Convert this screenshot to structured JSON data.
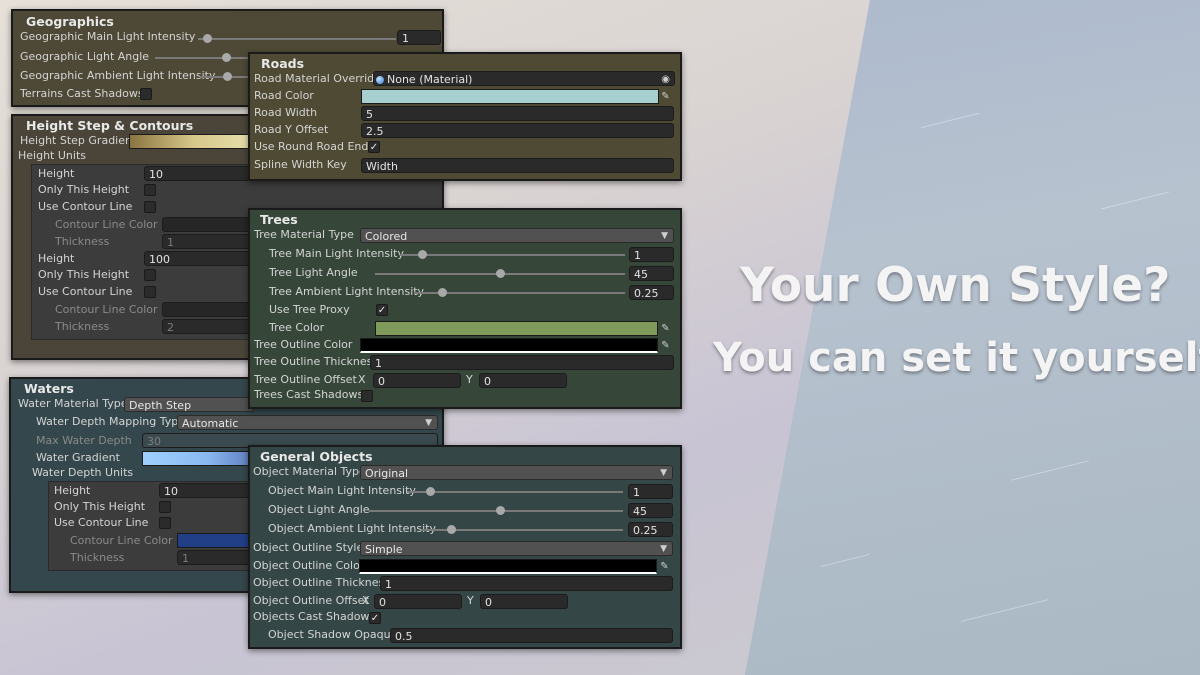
{
  "colors": {
    "geographics_bg": "#4e4936",
    "height_bg": "#4a4538",
    "roads_bg": "#4f4a33",
    "trees_bg": "#36473a",
    "waters_bg": "#34474c",
    "general_bg": "#344746",
    "road_color": "#a8cfcf",
    "tree_color": "#7f9a5a",
    "water_gradient_start": "#9fd0ff",
    "water_gradient_end": "#5f7fbf",
    "contour_blue": "#213f86"
  },
  "headline": {
    "line1": "Your Own Style?",
    "line2": "You can set it yourself"
  },
  "geographics": {
    "title": "Geographics",
    "main_light_label": "Geographic Main Light Intensity",
    "main_light_value": "1",
    "light_angle_label": "Geographic Light Angle",
    "ambient_label": "Geographic Ambient Light Intensity",
    "terrains_shadows_label": "Terrains Cast Shadows"
  },
  "height": {
    "title": "Height Step & Contours",
    "gradient_label": "Height Step Gradient",
    "units_label": "Height Units",
    "unit1": {
      "height_label": "Height",
      "height_value": "10",
      "only_label": "Only This Height",
      "contour_label": "Use Contour Line",
      "contour_color_label": "Contour Line Color",
      "thickness_label": "Thickness",
      "thickness_value": "1"
    },
    "unit2": {
      "height_label": "Height",
      "height_value": "100",
      "only_label": "Only This Height",
      "contour_label": "Use Contour Line",
      "contour_color_label": "Contour Line Color",
      "thickness_label": "Thickness",
      "thickness_value": "2"
    }
  },
  "roads": {
    "title": "Roads",
    "material_label": "Road Material Override",
    "material_value": "None (Material)",
    "color_label": "Road Color",
    "width_label": "Road Width",
    "width_value": "5",
    "yoffset_label": "Road Y Offset",
    "yoffset_value": "2.5",
    "round_ends_label": "Use Round Road Ends",
    "spline_label": "Spline Width Key",
    "spline_value": "Width"
  },
  "trees": {
    "title": "Trees",
    "material_type_label": "Tree Material Type",
    "material_type_value": "Colored",
    "main_light_label": "Tree Main Light Intensity",
    "main_light_value": "1",
    "light_angle_label": "Tree Light Angle",
    "light_angle_value": "45",
    "ambient_label": "Tree Ambient Light Intensity",
    "ambient_value": "0.25",
    "proxy_label": "Use Tree Proxy",
    "color_label": "Tree Color",
    "outline_color_label": "Tree Outline Color",
    "outline_thickness_label": "Tree Outline Thickness",
    "outline_thickness_value": "1",
    "outline_offset_label": "Tree Outline Offset",
    "x_label": "X",
    "x_value": "0",
    "y_label": "Y",
    "y_value": "0",
    "shadows_label": "Trees Cast Shadows"
  },
  "waters": {
    "title": "Waters",
    "material_type_label": "Water Material Type",
    "material_type_value": "Depth Step",
    "mapping_label": "Water Depth Mapping Type",
    "mapping_value": "Automatic",
    "max_depth_label": "Max Water Depth",
    "max_depth_value": "30",
    "gradient_label": "Water Gradient",
    "units_label": "Water Depth Units",
    "height_label": "Height",
    "height_value": "10",
    "only_label": "Only This Height",
    "contour_label": "Use Contour Line",
    "contour_color_label": "Contour Line Color",
    "thickness_label": "Thickness",
    "thickness_value": "1"
  },
  "general": {
    "title": "General Objects",
    "material_type_label": "Object Material Type",
    "material_type_value": "Original",
    "main_light_label": "Object Main Light Intensity",
    "main_light_value": "1",
    "light_angle_label": "Object Light Angle",
    "light_angle_value": "45",
    "ambient_label": "Object Ambient Light Intensity",
    "ambient_value": "0.25",
    "outline_style_label": "Object Outline Style",
    "outline_style_value": "Simple",
    "outline_color_label": "Object Outline Color",
    "outline_thickness_label": "Object Outline Thickness",
    "outline_thickness_value": "1",
    "outline_offset_label": "Object Outline Offset",
    "x_label": "X",
    "x_value": "0",
    "y_label": "Y",
    "y_value": "0",
    "shadows_label": "Objects Cast Shadows",
    "shadow_opaque_label": "Object Shadow Opaque",
    "shadow_opaque_value": "0.5"
  }
}
